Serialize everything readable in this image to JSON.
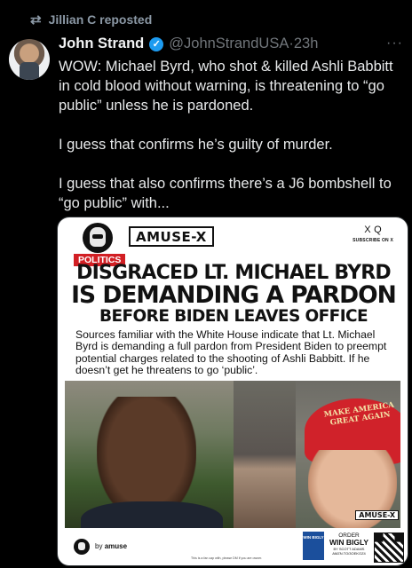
{
  "repost": {
    "icon": "repost-icon",
    "text": "Jillian C reposted"
  },
  "post": {
    "author": "John Strand",
    "verified_icon": "verified-badge-icon",
    "handle": "@JohnStrandUSA",
    "separator": "·",
    "time": "23h",
    "more_icon": "more-options-icon",
    "paragraphs": [
      "WOW: Michael Byrd, who shot & killed Ashli Babbitt in cold blood without warning, is threatening to “go public” unless he is pardoned.",
      "I guess that confirms he’s guilty of murder.",
      "I guess that also confirms there’s a J6 bombshell to “go public” with..."
    ]
  },
  "media": {
    "brand": "AMUSE-X",
    "subscribe_icons": "X Q",
    "subscribe_text": "SUBSCRIBE ON X",
    "tag": "POLITICS",
    "headline": [
      "DISGRACED LT. MICHAEL BYRD",
      "IS DEMANDING A PARDON",
      "BEFORE BIDEN LEAVES OFFICE"
    ],
    "body": "Sources familiar with the White House indicate that Lt. Michael Byrd is demanding a full pardon from President Biden to preempt potential charges related to the shooting of Ashli Babbitt. If he doesn’t get he threatens to go ‘public’.",
    "cap_text": "MAKE AMERICA GREAT AGAIN",
    "stamp": "AMUSE-X",
    "footer": {
      "by_prefix": "by",
      "by_name": "amuse",
      "note": "This is a fan cap with, please DM if you are owner.",
      "book_label": "WIN BIGLY",
      "order_label": "ORDER",
      "order_title": "WIN BIGLY",
      "order_author": "BY SCOTT ADAMS",
      "order_link": "AMZN.TO/3OEKOZ4"
    }
  }
}
